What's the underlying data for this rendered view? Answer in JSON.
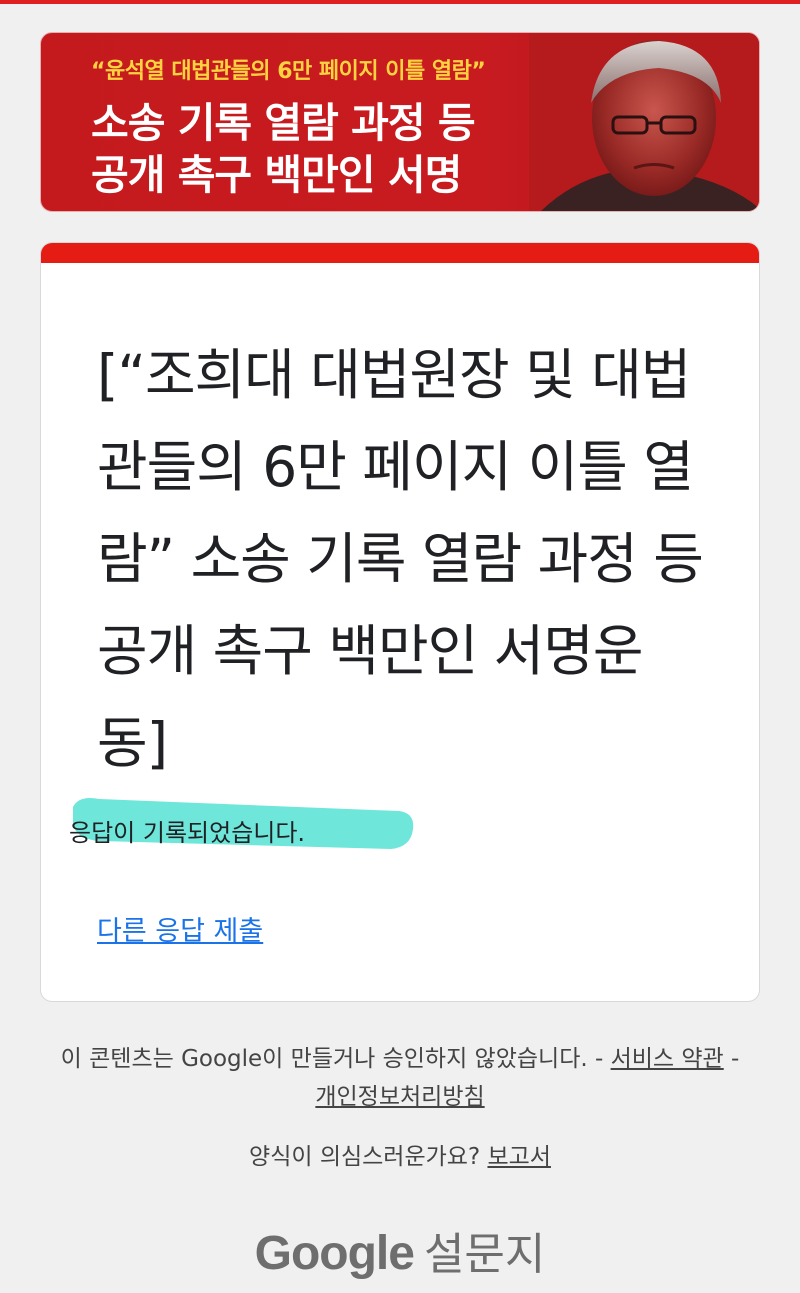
{
  "banner": {
    "quote": "“윤석열 대법관들의 6만 페이지 이틀 열람”",
    "line1": "소송 기록 열람 과정 등",
    "line2": "공개 촉구 백만인 서명"
  },
  "form": {
    "title": "[“조희대 대법원장 및 대법관들의 6만 페이지 이틀 열람” 소송 기록 열람 과정 등 공개 촉구 백만인 서명운동]",
    "confirmation": "응답이 기록되었습니다.",
    "another_response_link": "다른 응답 제출"
  },
  "footer": {
    "notice_text": "이 콘텐츠는 Google이 만들거나 승인하지 않았습니다. - ",
    "terms_link": "서비스 약관",
    "separator": " - ",
    "privacy_link": "개인정보처리방침",
    "report_text": "양식이 의심스러운가요? ",
    "report_link": "보고서",
    "logo_word": "Google",
    "logo_product": "설문지"
  },
  "colors": {
    "accent": "#e51c14",
    "link": "#1a73e8",
    "highlight": "#5fe3d6",
    "banner_red": "#c41a1e",
    "banner_quote_yellow": "#ffd23f"
  }
}
